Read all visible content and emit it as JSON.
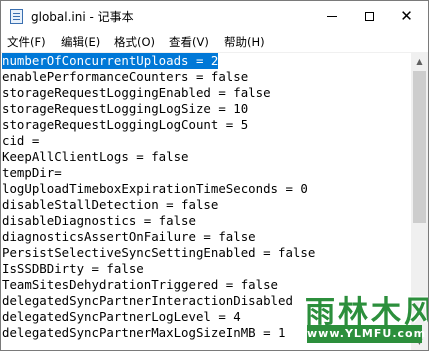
{
  "window": {
    "title": "global.ini - 记事本"
  },
  "menu": [
    {
      "label": "文件(F)"
    },
    {
      "label": "编辑(E)"
    },
    {
      "label": "格式(O)"
    },
    {
      "label": "查看(V)"
    },
    {
      "label": "帮助(H)"
    }
  ],
  "editor": {
    "lines": [
      "numberOfConcurrentUploads = 2",
      "enablePerformanceCounters = false",
      "storageRequestLoggingEnabled = false",
      "storageRequestLoggingLogSize = 10",
      "storageRequestLoggingLogCount = 5",
      "cid =",
      "KeepAllClientLogs = false",
      "tempDir=",
      "logUploadTimeboxExpirationTimeSeconds = 0",
      "disableStallDetection = false",
      "disableDiagnostics = false",
      "diagnosticsAssertOnFailure = false",
      "PersistSelectiveSyncSettingEnabled = false",
      "IsSSDBDirty = false",
      "TeamSitesDehydrationTriggered = false",
      "delegatedSyncPartnerInteractionDisabled",
      "delegatedSyncPartnerLogLevel = 4",
      "delegatedSyncPartnerMaxLogSizeInMB = 1"
    ]
  },
  "watermark": {
    "title": "雨林木风",
    "url": "www.YLMFU.com"
  }
}
